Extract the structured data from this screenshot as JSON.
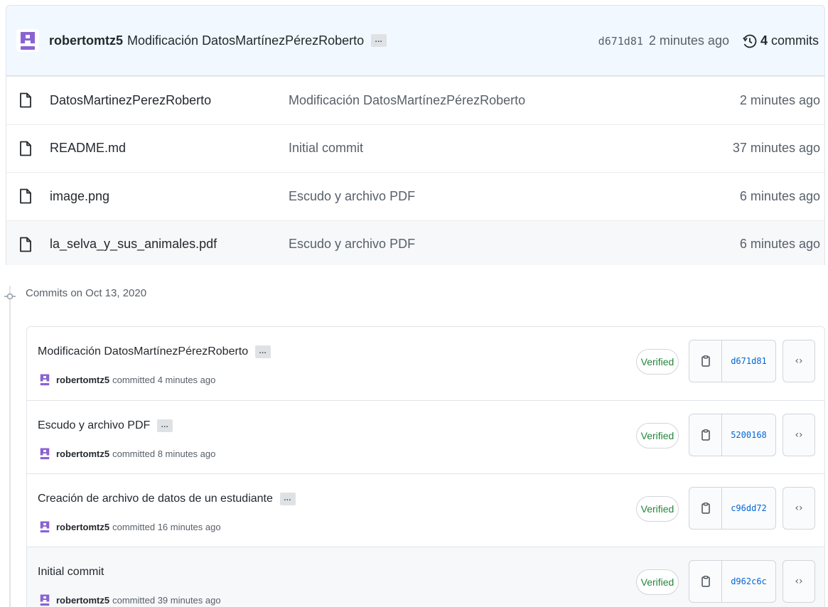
{
  "latest_commit": {
    "author": "robertomtz5",
    "message": "Modificación DatosMartínezPérezRoberto",
    "ellipsis": "…",
    "sha": "d671d81",
    "time": "2 minutes ago",
    "commit_count": "4",
    "commit_label": "commits"
  },
  "files": [
    {
      "name": "DatosMartinezPerezRoberto",
      "message": "Modificación DatosMartínezPérezRoberto",
      "age": "2 minutes ago"
    },
    {
      "name": "README.md",
      "message": "Initial commit",
      "age": "37 minutes ago"
    },
    {
      "name": "image.png",
      "message": "Escudo y archivo PDF",
      "age": "6 minutes ago"
    },
    {
      "name": "la_selva_y_sus_animales.pdf",
      "message": "Escudo y archivo PDF",
      "age": "6 minutes ago"
    }
  ],
  "history": {
    "date_heading": "Commits on Oct 13, 2020",
    "commits": [
      {
        "title": "Modificación DatosMartínezPérezRoberto",
        "has_ellipsis": true,
        "author": "robertomtz5",
        "meta": "committed 4 minutes ago",
        "verified": "Verified",
        "sha": "d671d81"
      },
      {
        "title": "Escudo y archivo PDF",
        "has_ellipsis": true,
        "author": "robertomtz5",
        "meta": "committed 8 minutes ago",
        "verified": "Verified",
        "sha": "5200168"
      },
      {
        "title": "Creación de archivo de datos de un estudiante",
        "has_ellipsis": true,
        "author": "robertomtz5",
        "meta": "committed 16 minutes ago",
        "verified": "Verified",
        "sha": "c96dd72"
      },
      {
        "title": "Initial commit",
        "has_ellipsis": false,
        "author": "robertomtz5",
        "meta": "committed 39 minutes ago",
        "verified": "Verified",
        "sha": "d962c6c"
      }
    ]
  },
  "colors": {
    "accent_link": "#0366d6",
    "verified_green": "#22863a",
    "avatar_purple": "#8a63d2"
  },
  "icons": {
    "file": "file-icon",
    "history": "history-icon",
    "copy": "clipboard-icon",
    "browse": "code-icon",
    "avatar": "avatar-icon"
  }
}
